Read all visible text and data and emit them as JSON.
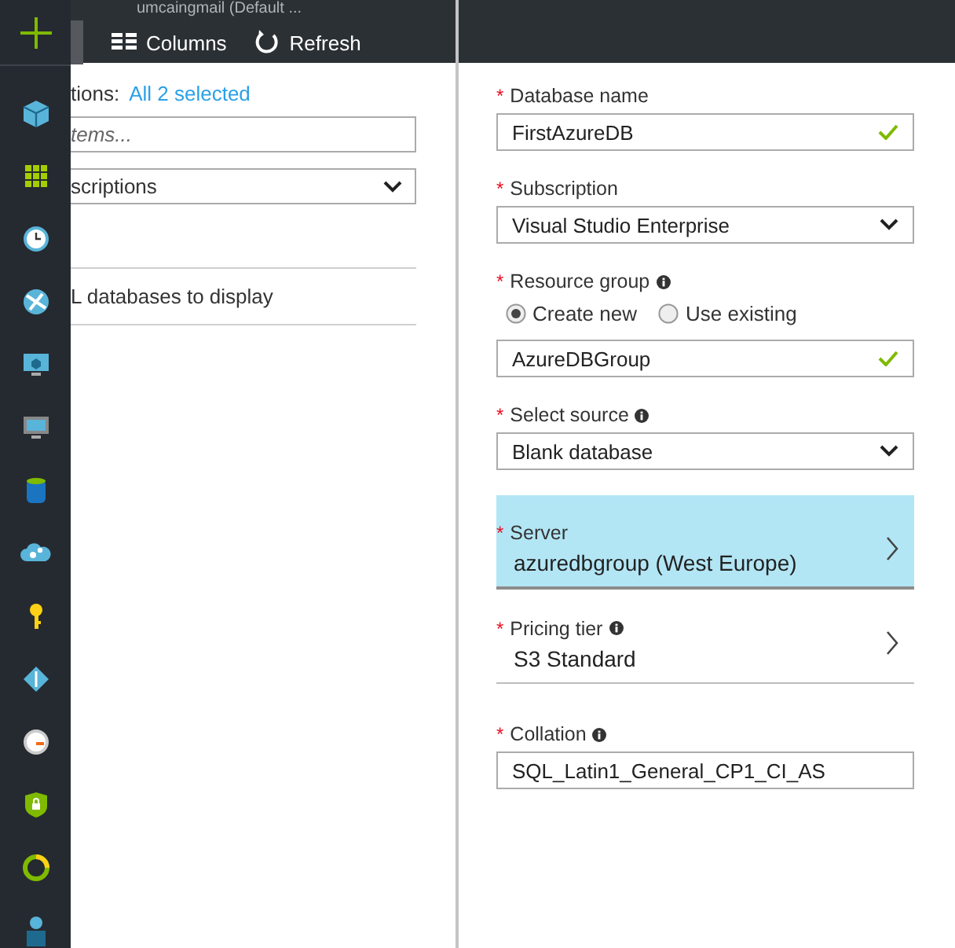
{
  "account_header": {
    "text": "umcaingmail (Default ..."
  },
  "toolbar": [
    {
      "label": "Columns",
      "kind": "columns"
    },
    {
      "label": "Refresh",
      "kind": "refresh"
    }
  ],
  "filter": {
    "label": "tions:",
    "link": "All 2 selected",
    "search": {
      "placeholder": "tems..."
    },
    "dropdown": {
      "value": "scriptions"
    }
  },
  "list": {
    "empty_message": "L databases to display"
  },
  "form": {
    "fields": [
      {
        "kind": "text",
        "required_mark": "*",
        "label": "Database name",
        "info": false,
        "value": "FirstAzureDB",
        "valid": true
      },
      {
        "kind": "select",
        "required_mark": "*",
        "label": "Subscription",
        "info": false,
        "value": "Visual Studio Enterprise"
      },
      {
        "kind": "radio",
        "required_mark": "*",
        "label": "Resource group",
        "info": true,
        "options": [
          {
            "label": "Create new",
            "selected": true
          },
          {
            "label": "Use existing",
            "selected": false
          }
        ]
      },
      {
        "kind": "text",
        "value": "AzureDBGroup",
        "valid": true
      },
      {
        "kind": "select",
        "required_mark": "*",
        "label": "Select source",
        "info": true,
        "value": "Blank database"
      },
      {
        "kind": "nav",
        "required_mark": "*",
        "label": "Server",
        "info": false,
        "value": "azuredbgroup (West Europe)",
        "selected": true
      },
      {
        "kind": "nav",
        "required_mark": "*",
        "label": "Pricing tier",
        "info": true,
        "value": "S3 Standard",
        "selected": false
      },
      {
        "kind": "text",
        "required_mark": "*",
        "label": "Collation",
        "info": true,
        "value": "SQL_Latin1_General_CP1_CI_AS",
        "valid": false
      }
    ]
  }
}
